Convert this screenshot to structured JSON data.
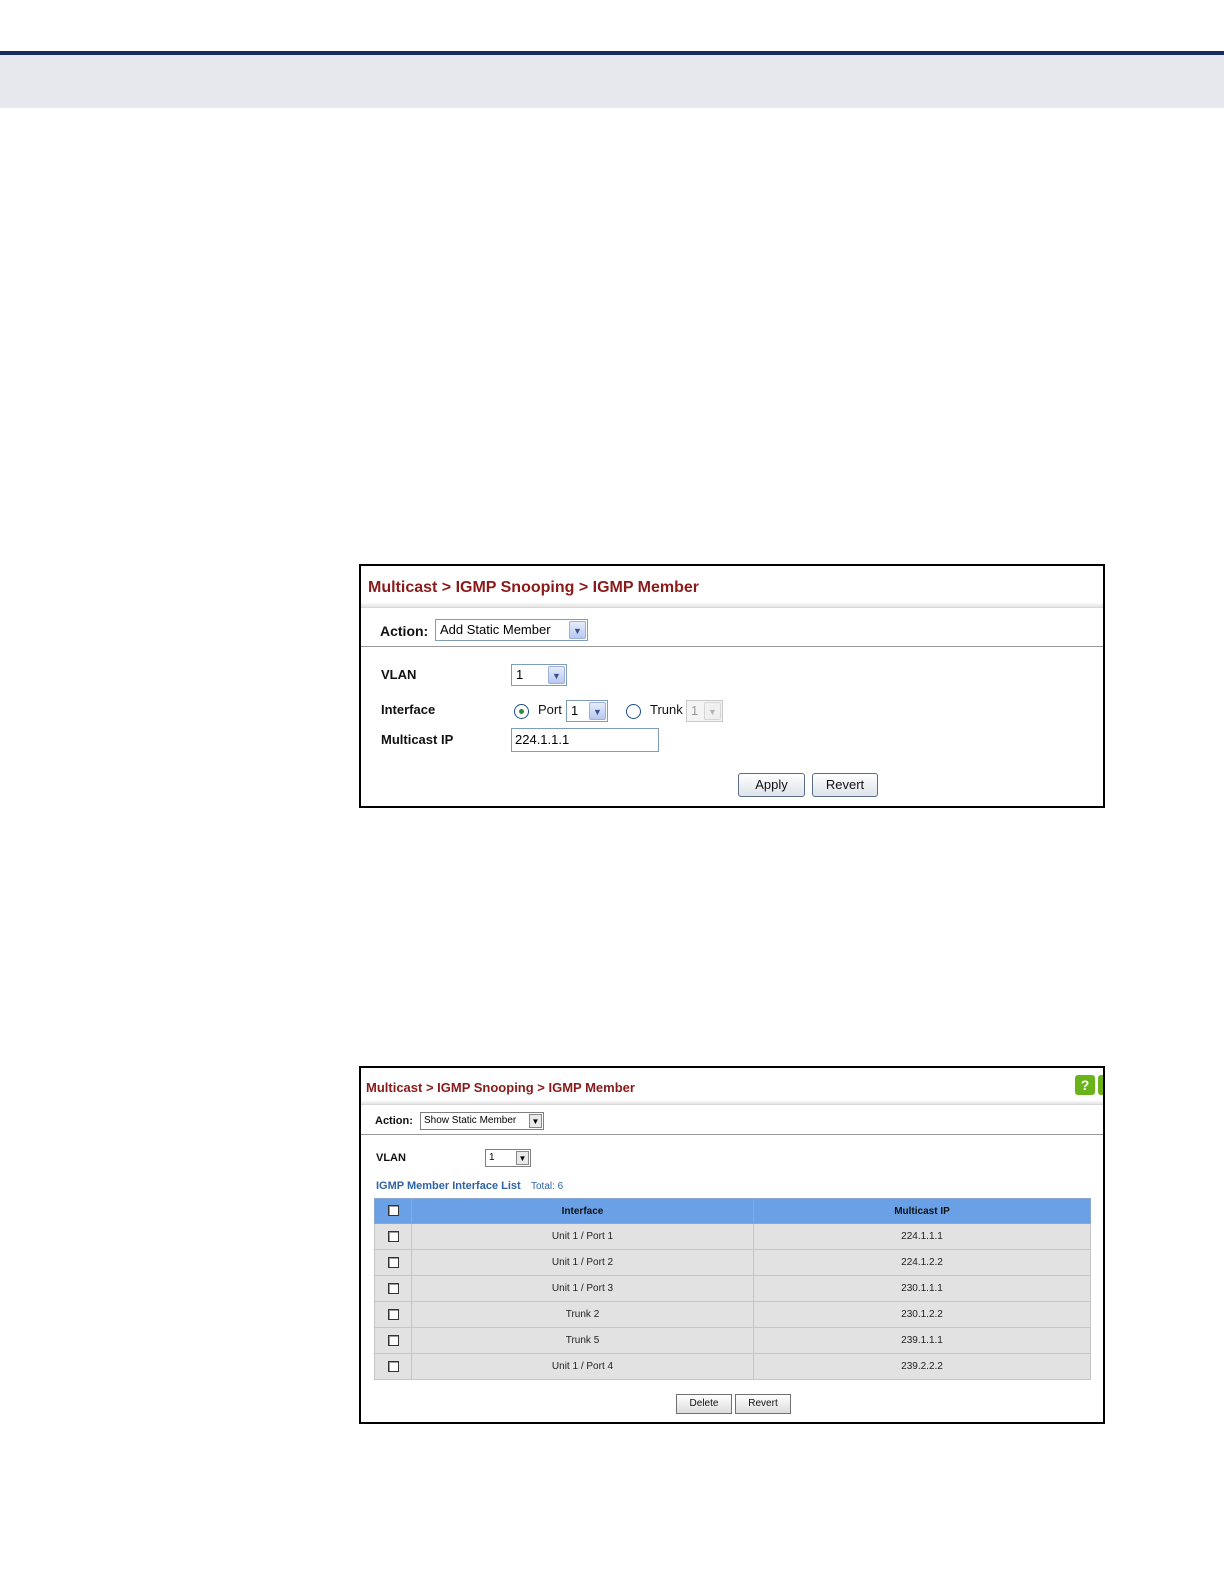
{
  "panel_add": {
    "breadcrumb": "Multicast > IGMP Snooping > IGMP Member",
    "action_label": "Action:",
    "action_value": "Add Static Member",
    "vlan_label": "VLAN",
    "vlan_value": "1",
    "interface_label": "Interface",
    "port_label": "Port",
    "port_value": "1",
    "trunk_label": "Trunk",
    "trunk_value": "1",
    "multicast_ip_label": "Multicast IP",
    "multicast_ip_value": "224.1.1.1",
    "apply_label": "Apply",
    "revert_label": "Revert"
  },
  "panel_show": {
    "breadcrumb": "Multicast > IGMP Snooping > IGMP Member",
    "help_icon": "?",
    "action_label": "Action:",
    "action_value": "Show Static Member",
    "vlan_label": "VLAN",
    "vlan_value": "1",
    "list_title": "IGMP Member Interface List",
    "list_total": "Total: 6",
    "columns": [
      "Interface",
      "Multicast IP"
    ],
    "rows": [
      {
        "interface": "Unit 1 / Port 1",
        "multicast_ip": "224.1.1.1"
      },
      {
        "interface": "Unit 1 / Port 2",
        "multicast_ip": "224.1.2.2"
      },
      {
        "interface": "Unit 1 / Port 3",
        "multicast_ip": "230.1.1.1"
      },
      {
        "interface": "Trunk 2",
        "multicast_ip": "230.1.2.2"
      },
      {
        "interface": "Trunk 5",
        "multicast_ip": "239.1.1.1"
      },
      {
        "interface": "Unit 1 / Port 4",
        "multicast_ip": "239.2.2.2"
      }
    ],
    "delete_label": "Delete",
    "revert_label": "Revert"
  },
  "colors": {
    "title": "#8b1a1a",
    "header_rule": "#1b2a5e",
    "table_header": "#6aa0e6",
    "list_title": "#2e63a8",
    "help_icon": "#6bb31a"
  }
}
